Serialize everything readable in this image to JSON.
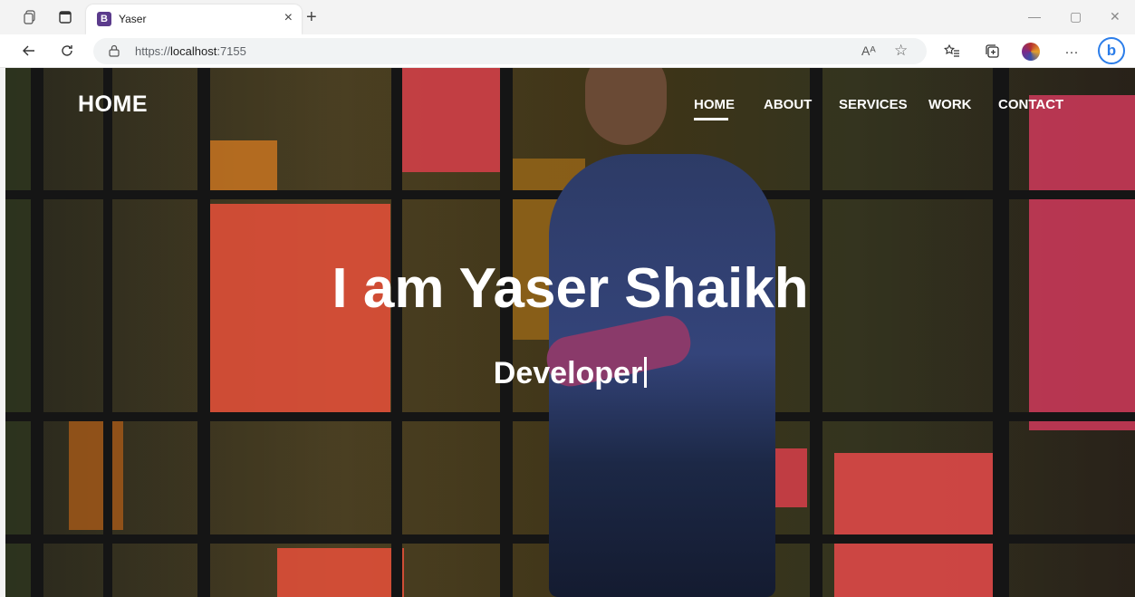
{
  "browser": {
    "tab_title": "Yaser",
    "tab_favicon_letter": "B",
    "url_scheme": "https://",
    "url_host": "localhost",
    "url_port": ":7155",
    "read_aloud_glyph": "Aᴬ",
    "more_glyph": "···",
    "bing_glyph": "b"
  },
  "site": {
    "brand": "HOME",
    "nav": [
      "HOME",
      "ABOUT",
      "SERVICES",
      "WORK",
      "CONTACT"
    ],
    "active_nav": "HOME",
    "hero_title": "I am Yaser Shaikh",
    "hero_subtitle": "Developer"
  },
  "colors": {
    "accent_browser": "#2b7de9",
    "text_on_hero": "#ffffff"
  }
}
